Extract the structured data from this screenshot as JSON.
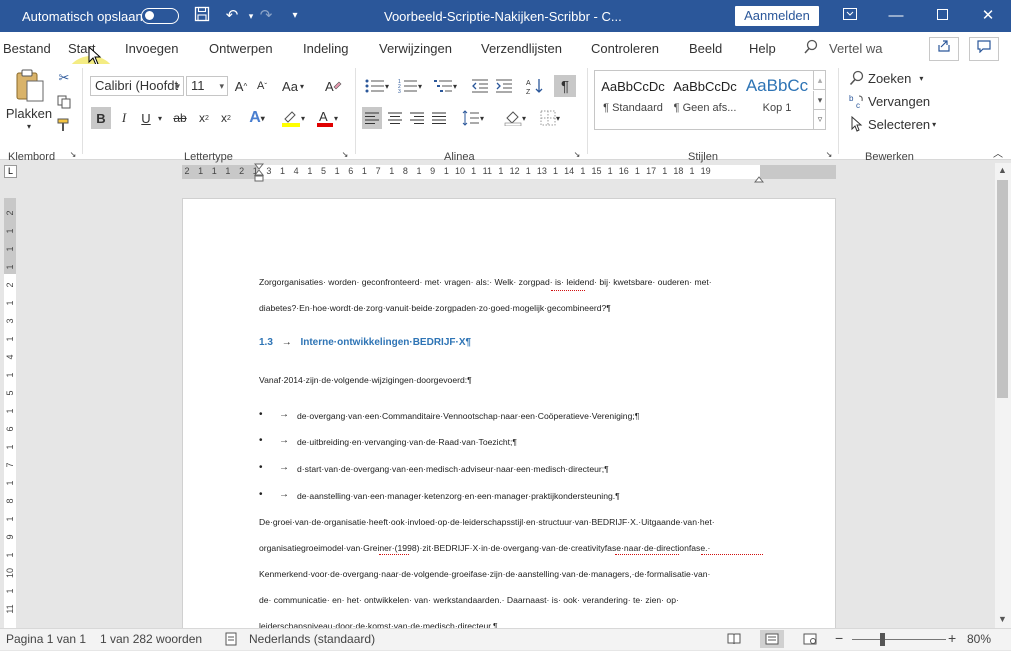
{
  "titlebar": {
    "autosave_label": "Automatisch opslaan",
    "document_title": "Voorbeeld-Scriptie-Nakijken-Scribbr  -  C...",
    "signin_label": "Aanmelden"
  },
  "menu": {
    "items": [
      "Bestand",
      "Start",
      "Invoegen",
      "Ontwerpen",
      "Indeling",
      "Verwijzingen",
      "Verzendlijsten",
      "Controleren",
      "Beeld",
      "Help"
    ],
    "tell_me": "Vertel wa"
  },
  "ribbon": {
    "paste_label": "Plakken",
    "font_name": "Calibri (Hoofdt",
    "font_size": "11",
    "font_case_label": "Aa",
    "styles": [
      {
        "preview": "AaBbCcDc",
        "name": "¶ Standaard"
      },
      {
        "preview": "AaBbCcDc",
        "name": "¶ Geen afs..."
      },
      {
        "preview": "AaBbCc",
        "name": "Kop 1"
      }
    ],
    "find_label": "Zoeken",
    "replace_label": "Vervangen",
    "select_label": "Selecteren",
    "groups": [
      "Klembord",
      "Lettertype",
      "Alinea",
      "Stijlen",
      "Bewerken"
    ]
  },
  "ruler": {
    "ticks": [
      "2",
      "1",
      "1",
      "1",
      "2",
      "1",
      "3",
      "1",
      "4",
      "1",
      "5",
      "1",
      "6",
      "1",
      "7",
      "1",
      "8",
      "1",
      "9",
      "1",
      "10",
      "1",
      "11",
      "1",
      "12",
      "1",
      "13",
      "1",
      "14",
      "1",
      "15",
      "1",
      "16",
      "1",
      "17",
      "1",
      "18",
      "1",
      "19"
    ],
    "vticks": [
      "2",
      "1",
      "1",
      "1",
      "2",
      "1",
      "3",
      "1",
      "4",
      "1",
      "5",
      "1",
      "6",
      "1",
      "7",
      "1",
      "8",
      "1",
      "9",
      "1",
      "10",
      "1",
      "11"
    ]
  },
  "document": {
    "para1_line1": "Zorgorganisaties· worden· geconfronteerd· met· vragen· als:· Welk· zorgpad· is· leidend· bij· kwetsbare· ouderen· met·",
    "para1_line2": "diabetes?·En·hoe·wordt·de·zorg·vanuit·beide·zorgpaden·zo·goed·mogelijk·gecombineerd?¶",
    "heading_number": "1.3",
    "heading_text": "Interne·ontwikkelingen·BEDRIJF·X¶",
    "para2": "Vanaf·2014·zijn·de·volgende·wijzigingen·doorgevoerd:¶",
    "bullets": [
      "de·overgang·van·een·Commanditaire·Vennootschap·naar·een·Coöperatieve·Vereniging;¶",
      "de·uitbreiding·en·vervanging·van·de·Raad·van·Toezicht;¶",
      "d·start·van·de·overgang·van·een·medisch·adviseur·naar·een·medisch·directeur;¶",
      "de·aanstelling·van·een·manager·ketenzorg·en·een·manager·praktijkondersteuning.¶"
    ],
    "para3_line1": "De·groei·van·de·organisatie·heeft·ook·invloed·op·de·leiderschapsstijl·en·structuur·van·BEDRIJF·X.·Uitgaande·van·het·",
    "para3_line2": "organisatiegroeimodel·van·Greiner·(1998)·zit·BEDRIJF·X·in·de·overgang·van·de·creativityfase·naar·de·directionfase.·",
    "para3_line3": "Kenmerkend·voor·de·overgang·naar·de·volgende·groeifase·zijn·de·aanstelling·van·de·managers,·de·formalisatie·van·",
    "para3_line4": "de·  communicatie·  en·  het·  ontwikkelen·  van·  werkstandaarden.·  Daarnaast·  is·  ook·  verandering·  te·  zien·  op·",
    "para3_line5": "leiderschapsniveau·door·de·komst·van·de·medisch·directeur.¶"
  },
  "status": {
    "page": "Pagina 1 van 1",
    "words": "1 van 282 woorden",
    "language": "Nederlands (standaard)",
    "zoom": "80%"
  },
  "colors": {
    "titlebar": "#2b579a",
    "heading": "#2e74b5",
    "highlight": "#f0e65a"
  }
}
